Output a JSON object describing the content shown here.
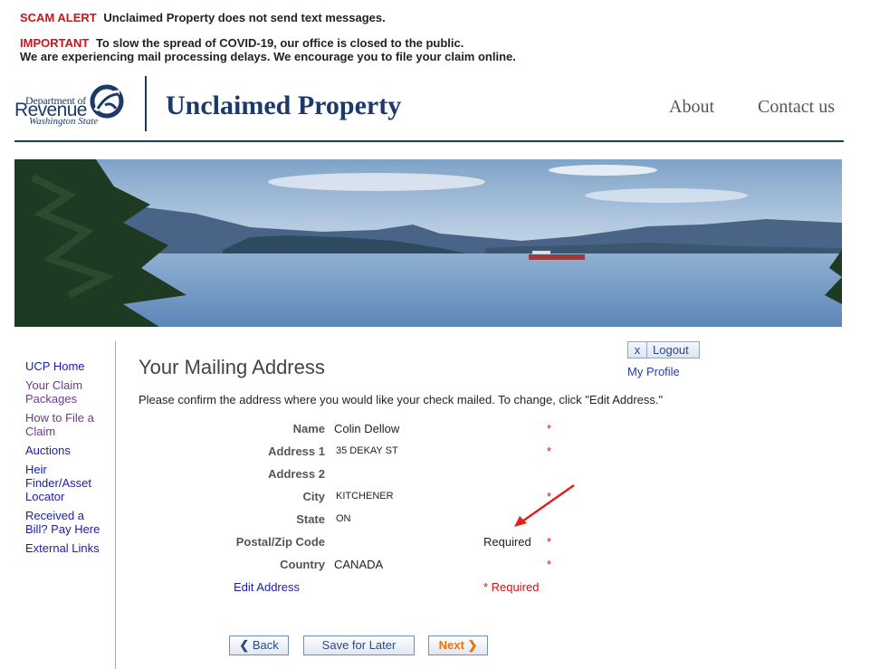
{
  "alerts": {
    "scam_label": "SCAM ALERT",
    "scam_text": "Unclaimed Property does not send text messages.",
    "important_label": "IMPORTANT",
    "important_text": "To slow the spread of COVID-19, our office is closed to the public.",
    "important_text2": "We are experiencing mail processing delays. We encourage you to file your claim online."
  },
  "logo": {
    "dept": "Department of",
    "name": "Revenue",
    "state": "Washington State"
  },
  "header": {
    "site_title": "Unclaimed Property",
    "nav": {
      "about": "About",
      "contact": "Contact us"
    }
  },
  "sidebar": {
    "items": [
      {
        "label": "UCP Home"
      },
      {
        "label": "Your Claim Packages"
      },
      {
        "label": "How to File a Claim"
      },
      {
        "label": "Auctions"
      },
      {
        "label": "Heir Finder/Asset Locator"
      },
      {
        "label": "Received a Bill? Pay Here"
      },
      {
        "label": "External Links"
      }
    ]
  },
  "account": {
    "logout_x": "x",
    "logout_label": "Logout",
    "profile_label": "My Profile"
  },
  "main": {
    "heading": "Your Mailing Address",
    "instructions": "Please confirm the address where you would like your check mailed. To change, click \"Edit Address.\"",
    "fields": {
      "name": {
        "label": "Name",
        "value": "Colin Dellow",
        "star": "*"
      },
      "address1": {
        "label": "Address 1",
        "value": "35 DEKAY ST",
        "star": "*"
      },
      "address2": {
        "label": "Address 2",
        "value": ""
      },
      "city": {
        "label": "City",
        "value": "KITCHENER",
        "star": "*"
      },
      "state": {
        "label": "State",
        "value": "ON"
      },
      "postal": {
        "label": "Postal/Zip Code",
        "value": "",
        "required_text": "Required",
        "star": "*"
      },
      "country": {
        "label": "Country",
        "value": "CANADA",
        "star": "*"
      }
    },
    "edit_address": "Edit Address",
    "required_note": "* Required"
  },
  "buttons": {
    "back": "Back",
    "back_chevron": "❮",
    "save": "Save for Later",
    "next": "Next",
    "next_chevron": "❯"
  },
  "colors": {
    "navy": "#1b3a6b",
    "alert_red": "#d0121a",
    "sidebar_rule": "#e6a13a",
    "link_blue": "#1c1ca8"
  }
}
